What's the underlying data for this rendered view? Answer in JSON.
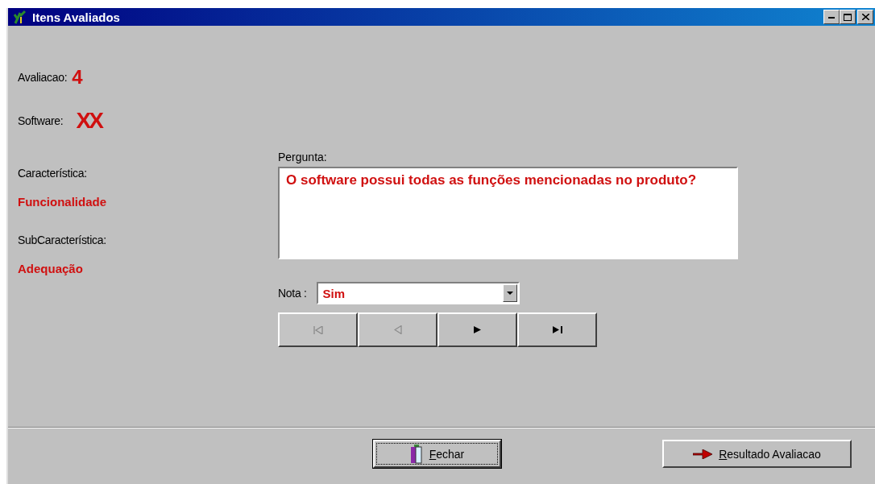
{
  "window": {
    "title": "Itens Avaliados"
  },
  "fields": [
    {
      "label": "Avaliacao:",
      "value": "4",
      "kind": "inline"
    },
    {
      "label": "Software:",
      "value": "XX",
      "kind": "inline"
    },
    {
      "label": "Característica:",
      "value": "Funcionalidade",
      "kind": "stacked"
    },
    {
      "label": "SubCaracterística:",
      "value": "Adequação",
      "kind": "stacked"
    }
  ],
  "question": {
    "label": "Pergunta:",
    "text": "O software possui todas as funções mencionadas no produto?"
  },
  "grade": {
    "label": "Nota :",
    "value": "Sim"
  },
  "navigation": [
    {
      "kind": "first",
      "disabled": true
    },
    {
      "kind": "prev",
      "disabled": true
    },
    {
      "kind": "next",
      "disabled": false
    },
    {
      "kind": "last",
      "disabled": false
    }
  ],
  "buttons": [
    {
      "label": "Fechar",
      "kind": "close",
      "focused": true,
      "underline_first": true
    },
    {
      "label": "Resultado Avaliacao",
      "kind": "result",
      "focused": false,
      "underline_first": true
    }
  ]
}
